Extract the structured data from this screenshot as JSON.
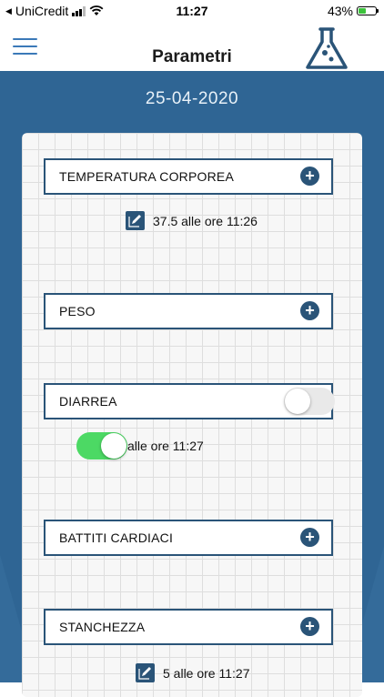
{
  "status_bar": {
    "carrier": "UniCredit",
    "time": "11:27",
    "battery": "43%",
    "battery_level": 0.43
  },
  "nav": {
    "title": "Parametri",
    "menu_icon": "hamburger-icon",
    "logo_icon": "flask-icon"
  },
  "date": "25-04-2020",
  "colors": {
    "primary": "#2a5478",
    "background_blue": "#2f6594",
    "toggle_on": "#4cd964"
  },
  "params": [
    {
      "label": "TEMPERATURA CORPOREA",
      "action": "plus",
      "entry": "37.5 alle ore 11:26"
    },
    {
      "label": "PESO",
      "action": "plus"
    },
    {
      "label": "DIARREA",
      "action": "toggle",
      "toggle_on": false,
      "entry": "alle ore 11:27",
      "entry_toggle_on": true
    },
    {
      "label": "BATTITI CARDIACI",
      "action": "plus"
    },
    {
      "label": "STANCHEZZA",
      "action": "plus",
      "entry": "5 alle ore 11:27"
    }
  ]
}
